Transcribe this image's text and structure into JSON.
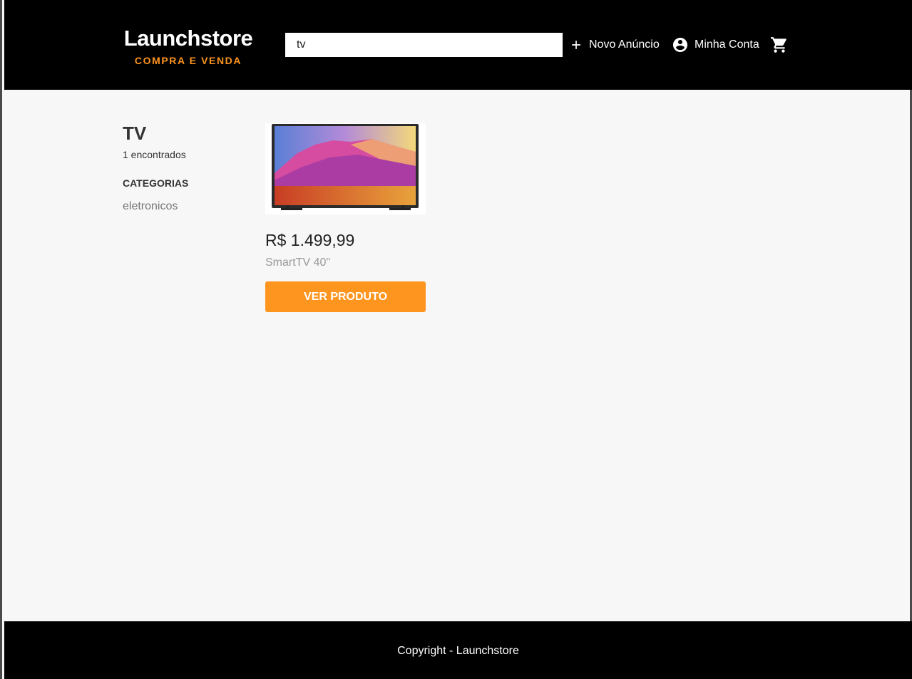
{
  "header": {
    "logo_title": "Launchstore",
    "logo_subtitle": "COMPRA E VENDA",
    "search_value": "tv",
    "new_ad_label": "Novo Anúncio",
    "account_label": "Minha Conta",
    "icons": [
      "plus-icon",
      "account-circle-icon",
      "shopping-cart-icon"
    ]
  },
  "sidebar": {
    "search_term": "TV",
    "found_count": "1 encontrados",
    "categories_title": "CATEGORIAS",
    "categories": [
      "eletronicos"
    ]
  },
  "products": [
    {
      "price": "R$ 1.499,99",
      "name": "SmartTV 40\"",
      "button_label": "VER PRODUTO"
    }
  ],
  "footer": {
    "copyright": "Copyright - Launchstore"
  },
  "colors": {
    "accent": "#fd951f",
    "header_bg": "#000000",
    "page_bg": "#f7f7f7"
  }
}
